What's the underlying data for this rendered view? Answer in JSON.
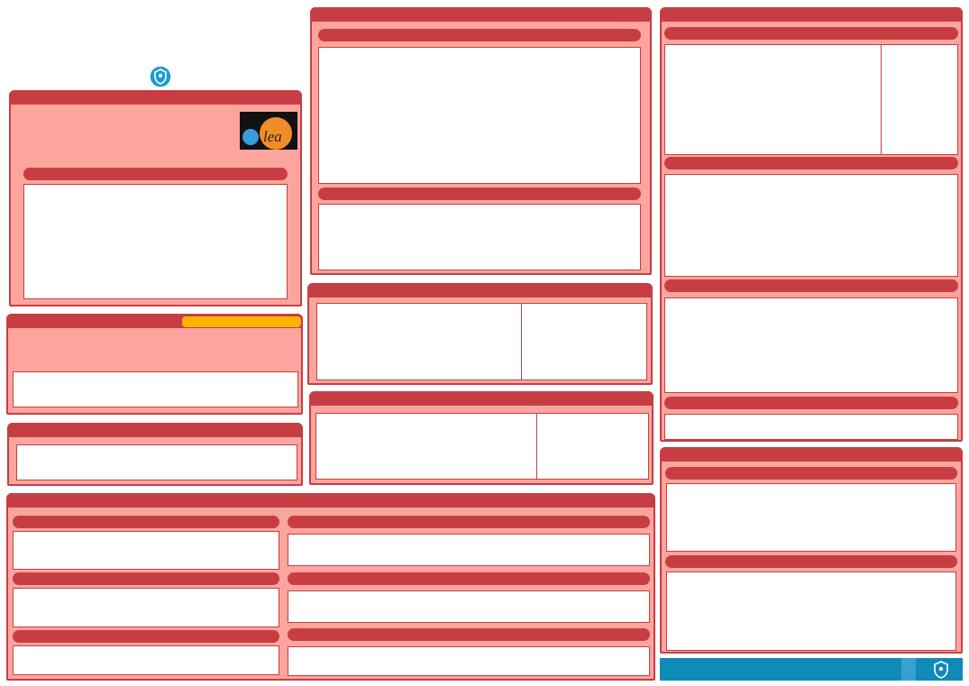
{
  "colors": {
    "panel_fill": "#fca59e",
    "panel_border": "#c73e42",
    "header_fill": "#c73e42",
    "accent_orange": "#f7b500",
    "footer_blue": "#0f8ab9",
    "shield_blue": "#1a9ccf"
  },
  "icons": {
    "top_logo": "shield-icon",
    "footer_logo": "shield-icon",
    "brand_logo": "learn-logo"
  },
  "logo": {
    "text": "lea"
  }
}
